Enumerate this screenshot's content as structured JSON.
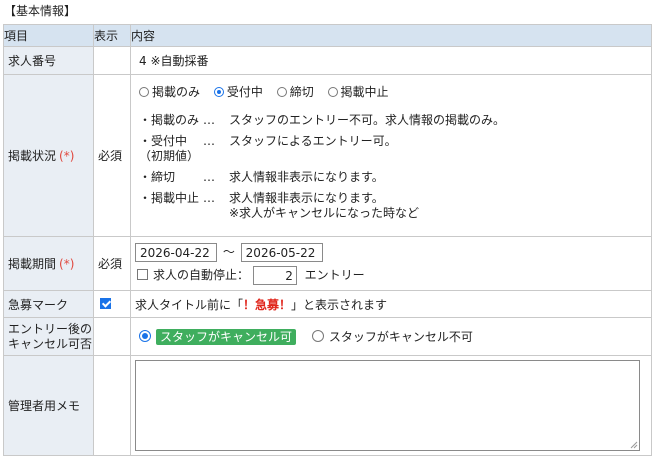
{
  "section_title": "【基本情報】",
  "header": {
    "item": "項目",
    "display": "表示",
    "content": "内容"
  },
  "job_number": {
    "label": "求人番号",
    "value": "4 ※自動採番"
  },
  "status": {
    "label": "掲載状況",
    "req_mark": "(*)",
    "required": "必須",
    "options": [
      {
        "label": "掲載のみ",
        "selected": false
      },
      {
        "label": "受付中",
        "selected": true
      },
      {
        "label": "締切",
        "selected": false
      },
      {
        "label": "掲載中止",
        "selected": false
      }
    ],
    "descriptions": [
      {
        "term": "・掲載のみ",
        "sep": "…",
        "text": "スタッフのエントリー不可。求人情報の掲載のみ。"
      },
      {
        "term": "・受付中\n（初期値）",
        "sep": "…",
        "text": "スタッフによるエントリー可。"
      },
      {
        "term": "・締切",
        "sep": "…",
        "text": "求人情報非表示になります。"
      },
      {
        "term": "・掲載中止",
        "sep": "…",
        "text": "求人情報非表示になります。\n※求人がキャンセルになった時など"
      }
    ]
  },
  "period": {
    "label": "掲載期間",
    "req_mark": "(*)",
    "required": "必須",
    "start": "2026-04-22",
    "tilde": "～",
    "end": "2026-05-22",
    "auto_stop_label": "求人の自動停止：",
    "auto_stop_value": "2",
    "auto_stop_unit": "エントリー",
    "auto_stop_checked": false
  },
  "urgent": {
    "label": "急募マーク",
    "checked": true,
    "text_before": "求人タイトル前に「",
    "urgent_text": "！急募！",
    "text_after": "」と表示されます"
  },
  "cancel": {
    "label_line1": "エントリー後の",
    "label_line2": "キャンセル可否",
    "option_yes": "スタッフがキャンセル可",
    "option_no": "スタッフがキャンセル不可",
    "selected": "yes"
  },
  "memo": {
    "label": "管理者用メモ",
    "value": ""
  },
  "colors": {
    "header_bg": "#d6e3f0",
    "label_bg": "#e9eef4",
    "required": "#e0483e",
    "urgent": "#e0261c",
    "tag_green": "#3fae5e",
    "accent": "#1a73e8"
  }
}
